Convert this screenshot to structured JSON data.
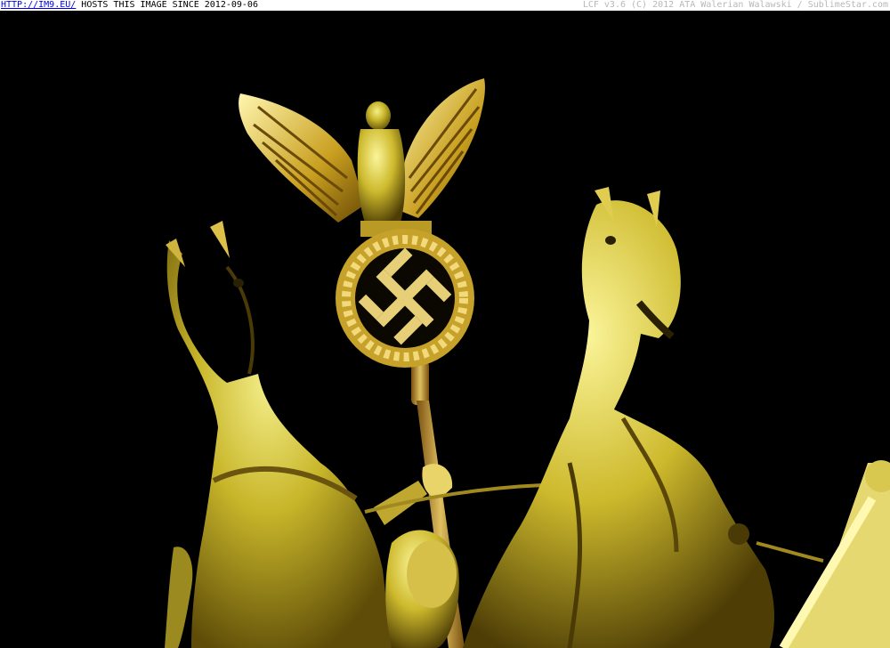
{
  "header": {
    "site_link": "HTTP://IM9.EU/",
    "hosts_text": "HOSTS THIS IMAGE SINCE 2012-09-06",
    "credit_text": "LCF v3.6 (C) 2012 ATA Walerian Walawski / SublimeStar.com"
  },
  "photo": {
    "subject": "Illuminated quadriga sculpture: two rearing horses, a charioteer figure holding a standard topped by an eagle above a wreath with a swastika",
    "palette": {
      "background": "#000000",
      "gold_light": "#e8e060",
      "gold_mid": "#b8a420",
      "gold_dark": "#5a4a08"
    }
  }
}
